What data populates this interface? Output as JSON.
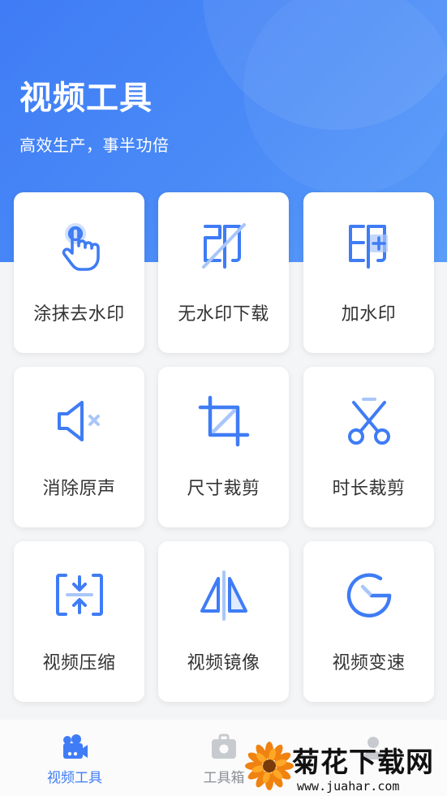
{
  "header": {
    "title": "视频工具",
    "subtitle": "高效生产，事半功倍"
  },
  "tools": [
    {
      "label": "涂抹去水印",
      "icon": "hand-tap-icon"
    },
    {
      "label": "无水印下载",
      "icon": "no-watermark-icon"
    },
    {
      "label": "加水印",
      "icon": "add-watermark-icon"
    },
    {
      "label": "消除原声",
      "icon": "mute-icon"
    },
    {
      "label": "尺寸裁剪",
      "icon": "crop-icon"
    },
    {
      "label": "时长裁剪",
      "icon": "scissors-icon"
    },
    {
      "label": "视频压缩",
      "icon": "compress-icon"
    },
    {
      "label": "视频镜像",
      "icon": "mirror-icon"
    },
    {
      "label": "视频变速",
      "icon": "speed-icon"
    }
  ],
  "tabbar": {
    "tabs": [
      {
        "label": "视频工具",
        "icon": "video-camera-icon",
        "active": true
      },
      {
        "label": "工具箱",
        "icon": "toolbox-icon",
        "active": false
      },
      {
        "label": "",
        "icon": "user-icon",
        "active": false
      }
    ]
  },
  "watermark": {
    "title": "菊花下载网",
    "url": "www.juahar.com"
  },
  "colors": {
    "accent": "#3f7cf5",
    "accent_light": "#a9c6fb",
    "text": "#333333",
    "muted": "#8b8f95"
  }
}
